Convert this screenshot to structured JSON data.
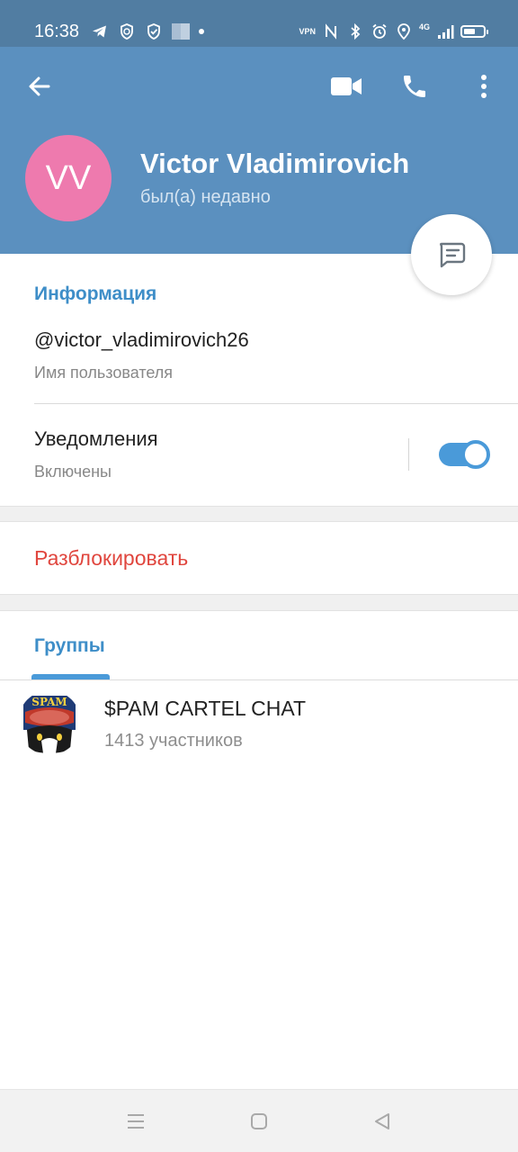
{
  "status_bar": {
    "time": "16:38",
    "vpn_label": "VPN",
    "network_label": "4G",
    "battery_level": 0.6
  },
  "header": {
    "avatar_initials": "VV",
    "avatar_color": "#ee7aae",
    "name": "Victor Vladimirovich",
    "status": "был(а) недавно",
    "background_color": "#5b90bf"
  },
  "info": {
    "section_title": "Информация",
    "username": "@victor_vladimirovich26",
    "username_caption": "Имя пользователя",
    "notifications_label": "Уведомления",
    "notifications_state": "Включены",
    "notifications_enabled": true
  },
  "actions": {
    "unblock_label": "Разблокировать"
  },
  "groups": {
    "tab_label": "Группы",
    "items": [
      {
        "name": "$PAM CARTEL CHAT",
        "members": "1413 участников",
        "avatar_text": "SPAM"
      }
    ]
  },
  "colors": {
    "accent": "#3e8ec8",
    "danger": "#e0463e",
    "toggle": "#4a9ad9"
  },
  "icons": [
    "telegram-icon",
    "shield-clock-icon",
    "shield-check-icon",
    "nfc-icon",
    "bluetooth-icon",
    "alarm-icon",
    "location-icon",
    "signal-icon",
    "battery-icon",
    "back-arrow-icon",
    "video-call-icon",
    "phone-icon",
    "more-vert-icon",
    "message-icon",
    "menu-icon",
    "home-icon",
    "back-triangle-icon"
  ]
}
